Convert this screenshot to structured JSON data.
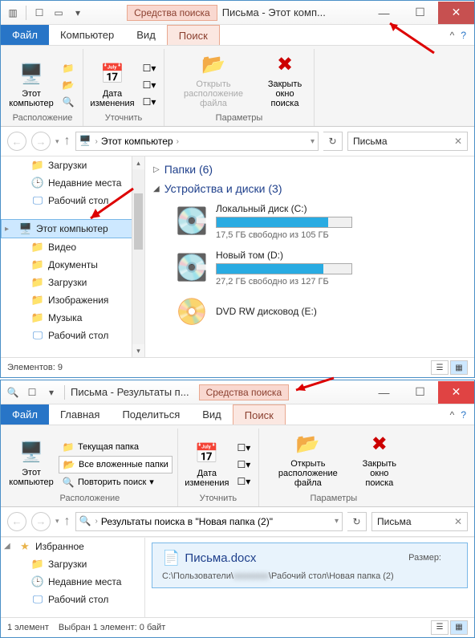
{
  "win1": {
    "search_tools": "Средства поиска",
    "title": "Письма - Этот комп...",
    "tabs": {
      "file": "Файл",
      "computer": "Компьютер",
      "view": "Вид",
      "search": "Поиск"
    },
    "ribbon": {
      "this_computer": "Этот компьютер",
      "small1": "",
      "small2": "",
      "group_location": "Расположение",
      "date_modified": "Дата изменения",
      "group_refine": "Уточнить",
      "open_location": "Открыть расположение файла",
      "close_search": "Закрыть окно поиска",
      "group_params": "Параметры"
    },
    "address": {
      "root": "Этот компьютер"
    },
    "search": {
      "value": "Письма"
    },
    "tree": {
      "downloads": "Загрузки",
      "recent": "Недавние места",
      "desktop": "Рабочий стол",
      "this_pc": "Этот компьютер",
      "video": "Видео",
      "documents": "Документы",
      "downloads2": "Загрузки",
      "pictures": "Изображения",
      "music": "Музыка",
      "desktop2": "Рабочий стол"
    },
    "content": {
      "folders_header": "Папки (6)",
      "drives_header": "Устройства и диски (3)",
      "drive_c": {
        "name": "Локальный диск (C:)",
        "free": "17,5 ГБ свободно из 105 ГБ",
        "fill": 83
      },
      "drive_d": {
        "name": "Новый том (D:)",
        "free": "27,2 ГБ свободно из 127 ГБ",
        "fill": 79
      },
      "drive_e": {
        "name": "DVD RW дисковод (E:)"
      }
    },
    "status": "Элементов: 9"
  },
  "win2": {
    "title": "Письма - Результаты п...",
    "search_tools": "Средства поиска",
    "tabs": {
      "file": "Файл",
      "home": "Главная",
      "share": "Поделиться",
      "view": "Вид",
      "search": "Поиск"
    },
    "ribbon": {
      "this_computer": "Этот компьютер",
      "current_folder": "Текущая папка",
      "all_subfolders": "Все вложенные папки",
      "search_again": "Повторить поиск ",
      "group_location": "Расположение",
      "date_modified": "Дата изменения",
      "group_refine": "Уточнить",
      "open_location": "Открыть расположение файла",
      "close_search": "Закрыть окно поиска",
      "group_params": "Параметры"
    },
    "address": "Результаты поиска в \"Новая папка (2)\"",
    "search": {
      "value": "Письма"
    },
    "tree": {
      "favorites": "Избранное",
      "downloads": "Загрузки",
      "recent": "Недавние места",
      "desktop": "Рабочий стол"
    },
    "result": {
      "name": "Письма.docx",
      "size_label": "Размер:",
      "path_prefix": "С:\\Пользователи\\",
      "path_suffix": "\\Рабочий стол\\Новая папка (2)"
    },
    "status": {
      "count": "1 элемент",
      "selected": "Выбран 1 элемент: 0 байт"
    }
  }
}
